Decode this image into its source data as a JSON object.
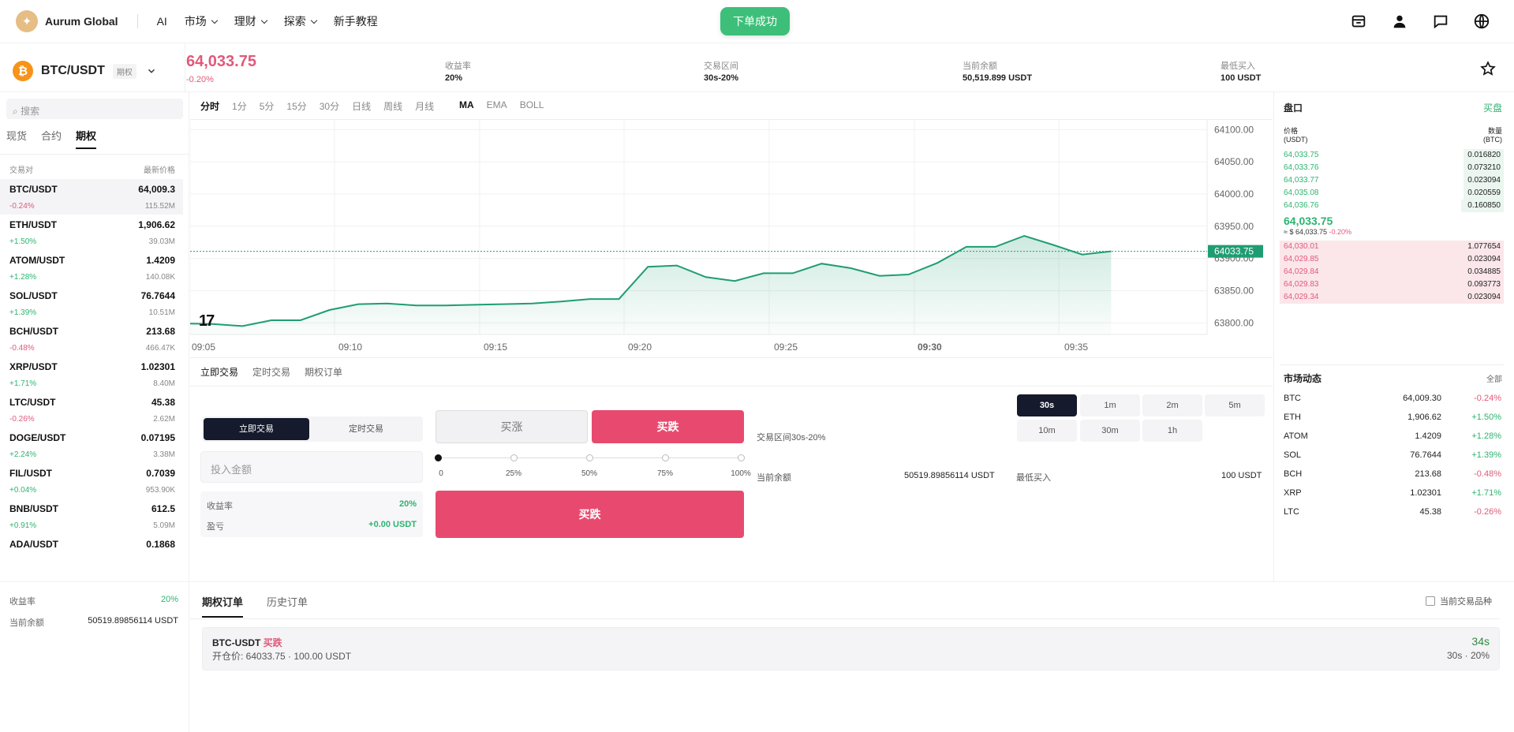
{
  "brand": {
    "name": "Aurum Global"
  },
  "nav": {
    "items": [
      {
        "label": "AI",
        "dropdown": false
      },
      {
        "label": "市场",
        "dropdown": true
      },
      {
        "label": "理财",
        "dropdown": true
      },
      {
        "label": "探索",
        "dropdown": true
      },
      {
        "label": "新手教程",
        "dropdown": false
      }
    ]
  },
  "toast": {
    "text": "下单成功"
  },
  "symbol": {
    "name": "BTC/USDT",
    "tag": "期权",
    "price": "64,033.75",
    "change": "-0.20%"
  },
  "stats": {
    "yield_label": "收益率",
    "yield_value": "20%",
    "range_label": "交易区间",
    "range_value": "30s-20%",
    "balance_label": "当前余额",
    "balance_value": "50,519.899 USDT",
    "min_label": "最低买入",
    "min_value": "100 USDT"
  },
  "sidebar": {
    "search_placeholder": "搜索",
    "tabs": [
      "现货",
      "合约",
      "期权"
    ],
    "head_pair": "交易对",
    "head_price": "最新价格",
    "markets": [
      {
        "pair": "BTC/USDT",
        "price": "64,009.3",
        "change": "-0.24%",
        "vol": "115.52M",
        "up": false
      },
      {
        "pair": "ETH/USDT",
        "price": "1,906.62",
        "change": "+1.50%",
        "vol": "39.03M",
        "up": true
      },
      {
        "pair": "ATOM/USDT",
        "price": "1.4209",
        "change": "+1.28%",
        "vol": "140.08K",
        "up": true
      },
      {
        "pair": "SOL/USDT",
        "price": "76.7644",
        "change": "+1.39%",
        "vol": "10.51M",
        "up": true
      },
      {
        "pair": "BCH/USDT",
        "price": "213.68",
        "change": "-0.48%",
        "vol": "466.47K",
        "up": false
      },
      {
        "pair": "XRP/USDT",
        "price": "1.02301",
        "change": "+1.71%",
        "vol": "8.40M",
        "up": true
      },
      {
        "pair": "LTC/USDT",
        "price": "45.38",
        "change": "-0.26%",
        "vol": "2.62M",
        "up": false
      },
      {
        "pair": "DOGE/USDT",
        "price": "0.07195",
        "change": "+2.24%",
        "vol": "3.38M",
        "up": true
      },
      {
        "pair": "FIL/USDT",
        "price": "0.7039",
        "change": "+0.04%",
        "vol": "953.90K",
        "up": true
      },
      {
        "pair": "BNB/USDT",
        "price": "612.5",
        "change": "+0.91%",
        "vol": "5.09M",
        "up": true
      },
      {
        "pair": "ADA/USDT",
        "price": "0.1868",
        "change": "",
        "vol": "",
        "up": true
      }
    ],
    "yield_label": "收益率",
    "yield_value": "20%",
    "balance_label": "当前余额",
    "balance_value": "50519.89856114 USDT"
  },
  "chart_toolbar": {
    "timeframes": [
      "分时",
      "1分",
      "5分",
      "15分",
      "30分",
      "日线",
      "周线",
      "月线"
    ],
    "indicators": [
      "MA",
      "EMA",
      "BOLL"
    ],
    "active_timeframe": "分时",
    "active_indicator": "MA"
  },
  "chart_data": {
    "type": "area",
    "x": [
      "09:04",
      "09:05",
      "09:06",
      "09:07",
      "09:08",
      "09:09",
      "09:10",
      "09:11",
      "09:12",
      "09:13",
      "09:14",
      "09:15",
      "09:16",
      "09:17",
      "09:18",
      "09:19",
      "09:20",
      "09:21",
      "09:22",
      "09:23",
      "09:24",
      "09:25",
      "09:26",
      "09:27",
      "09:28",
      "09:29",
      "09:30",
      "09:31",
      "09:32",
      "09:33",
      "09:34",
      "09:35",
      "09:36"
    ],
    "values": [
      63799,
      63798,
      63795,
      63804,
      63804,
      63820,
      63829,
      63830,
      63827,
      63827,
      63828,
      63829,
      63830,
      63833,
      63837,
      63837,
      63887,
      63889,
      63871,
      63865,
      63877,
      63877,
      63892,
      63885,
      63873,
      63875,
      63893,
      63918,
      63918,
      63935,
      63921,
      63906,
      63911
    ],
    "ylim": [
      63782,
      64115
    ],
    "yticks": [
      "64100.00",
      "64050.00",
      "64000.00",
      "63950.00",
      "63900.00",
      "63850.00",
      "63800.00"
    ],
    "xticks": [
      "09:05",
      "09:10",
      "09:15",
      "09:20",
      "09:25",
      "09:30",
      "09:35"
    ],
    "current_price_label": "64033.75",
    "color": "#1f9d72",
    "grid": true
  },
  "panel_tabs": [
    "立即交易",
    "定时交易",
    "期权订单"
  ],
  "trade": {
    "mode_a": "立即交易",
    "mode_b": "定时交易",
    "amount_placeholder": "投入金额",
    "yield_label": "收益率",
    "yield_value": "20%",
    "pnl_label": "盈亏",
    "pnl_value": "+0.00 USDT",
    "buy_up": "买涨",
    "buy_down": "买跌",
    "slider_labels": [
      "0",
      "25%",
      "50%",
      "75%",
      "100%"
    ],
    "slider_value": 0,
    "submit": "买跌",
    "range_text": "交易区间30s-20%",
    "balance_label": "当前余额",
    "balance_value": "50519.89856114 USDT",
    "min_label": "最低买入",
    "min_value": "100 USDT",
    "durations": [
      "30s",
      "1m",
      "2m",
      "5m",
      "10m",
      "30m",
      "1h"
    ],
    "active_duration": "30s"
  },
  "orderbook": {
    "title": "盘口",
    "more": "买盘",
    "price_h1": "价格",
    "price_h2": "(USDT)",
    "qty_h1": "数量",
    "qty_h2": "(BTC)",
    "asks": [
      {
        "p": "64,033.75",
        "q": "0.016820",
        "depth": 0.18
      },
      {
        "p": "64,033.76",
        "q": "0.073210",
        "depth": 0.18
      },
      {
        "p": "64,033.77",
        "q": "0.023094",
        "depth": 0.18
      },
      {
        "p": "64,035.08",
        "q": "0.020559",
        "depth": 0.18
      },
      {
        "p": "64,036.76",
        "q": "0.160850",
        "depth": 0.19
      }
    ],
    "mid_price": "64,033.75",
    "mid_sub": "≈ $ 64,033.75",
    "mid_change": "-0.20%",
    "bids": [
      {
        "p": "64,030.01",
        "q": "1.077654",
        "depth": 1.0
      },
      {
        "p": "64,029.85",
        "q": "0.023094",
        "depth": 1.0
      },
      {
        "p": "64,029.84",
        "q": "0.034885",
        "depth": 1.0
      },
      {
        "p": "64,029.83",
        "q": "0.093773",
        "depth": 1.0
      },
      {
        "p": "64,029.34",
        "q": "0.023094",
        "depth": 1.0
      }
    ]
  },
  "market_moves": {
    "title": "市场动态",
    "all": "全部",
    "rows": [
      {
        "n": "BTC",
        "p": "64,009.30",
        "c": "-0.24%",
        "up": false
      },
      {
        "n": "ETH",
        "p": "1,906.62",
        "c": "+1.50%",
        "up": true
      },
      {
        "n": "ATOM",
        "p": "1.4209",
        "c": "+1.28%",
        "up": true
      },
      {
        "n": "SOL",
        "p": "76.7644",
        "c": "+1.39%",
        "up": true
      },
      {
        "n": "BCH",
        "p": "213.68",
        "c": "-0.48%",
        "up": false
      },
      {
        "n": "XRP",
        "p": "1.02301",
        "c": "+1.71%",
        "up": true
      },
      {
        "n": "LTC",
        "p": "45.38",
        "c": "-0.26%",
        "up": false
      }
    ]
  },
  "orders": {
    "tabs": [
      "期权订单",
      "历史订单"
    ],
    "filter_label": "当前交易品种",
    "card": {
      "pair": "BTC-USDT",
      "side": "买跌",
      "detail": "开仓价: 64033.75 · 100.00 USDT",
      "countdown": "34s",
      "meta": "30s · 20%"
    }
  }
}
